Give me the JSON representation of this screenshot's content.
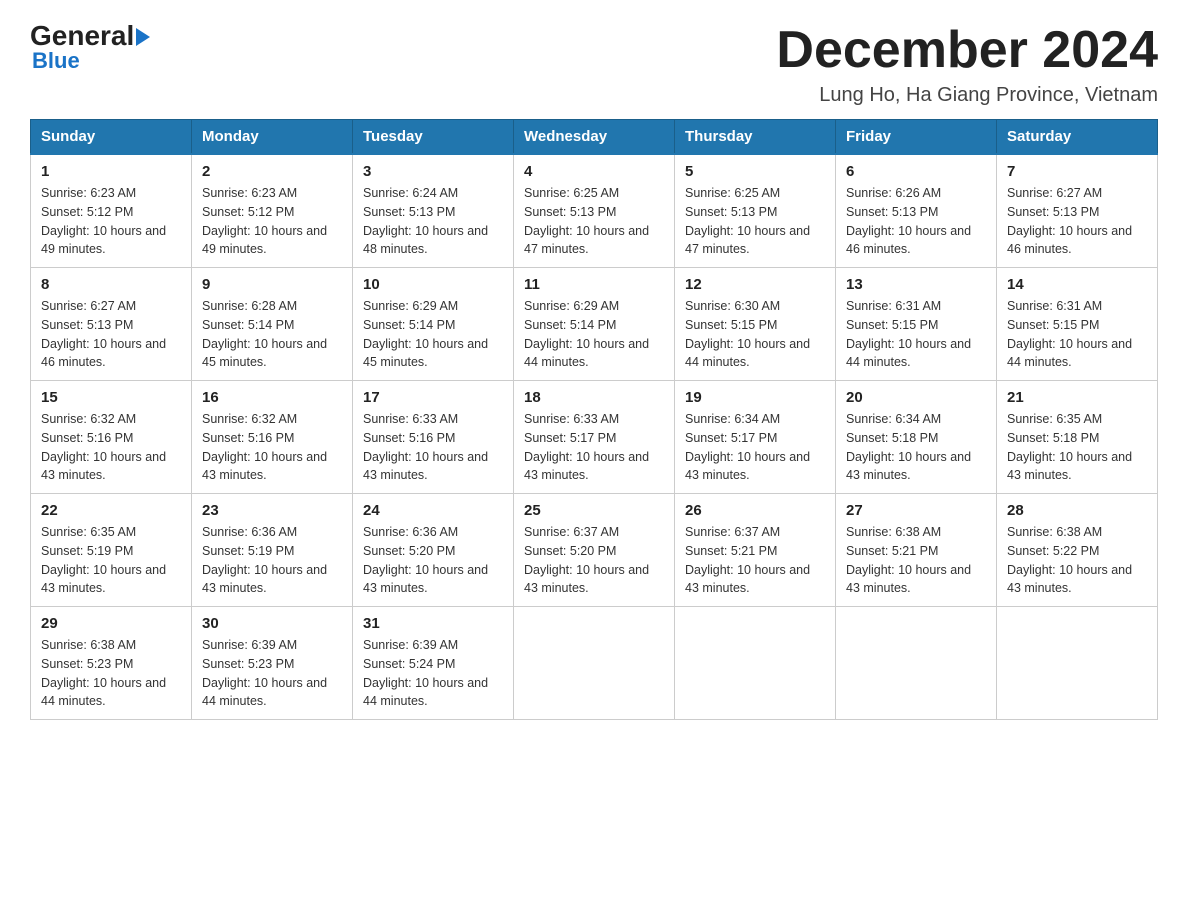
{
  "header": {
    "logo_general": "General",
    "logo_blue": "Blue",
    "main_title": "December 2024",
    "subtitle": "Lung Ho, Ha Giang Province, Vietnam"
  },
  "days_header": [
    "Sunday",
    "Monday",
    "Tuesday",
    "Wednesday",
    "Thursday",
    "Friday",
    "Saturday"
  ],
  "weeks": [
    [
      {
        "day": "1",
        "sunrise": "6:23 AM",
        "sunset": "5:12 PM",
        "daylight": "10 hours and 49 minutes."
      },
      {
        "day": "2",
        "sunrise": "6:23 AM",
        "sunset": "5:12 PM",
        "daylight": "10 hours and 49 minutes."
      },
      {
        "day": "3",
        "sunrise": "6:24 AM",
        "sunset": "5:13 PM",
        "daylight": "10 hours and 48 minutes."
      },
      {
        "day": "4",
        "sunrise": "6:25 AM",
        "sunset": "5:13 PM",
        "daylight": "10 hours and 47 minutes."
      },
      {
        "day": "5",
        "sunrise": "6:25 AM",
        "sunset": "5:13 PM",
        "daylight": "10 hours and 47 minutes."
      },
      {
        "day": "6",
        "sunrise": "6:26 AM",
        "sunset": "5:13 PM",
        "daylight": "10 hours and 46 minutes."
      },
      {
        "day": "7",
        "sunrise": "6:27 AM",
        "sunset": "5:13 PM",
        "daylight": "10 hours and 46 minutes."
      }
    ],
    [
      {
        "day": "8",
        "sunrise": "6:27 AM",
        "sunset": "5:13 PM",
        "daylight": "10 hours and 46 minutes."
      },
      {
        "day": "9",
        "sunrise": "6:28 AM",
        "sunset": "5:14 PM",
        "daylight": "10 hours and 45 minutes."
      },
      {
        "day": "10",
        "sunrise": "6:29 AM",
        "sunset": "5:14 PM",
        "daylight": "10 hours and 45 minutes."
      },
      {
        "day": "11",
        "sunrise": "6:29 AM",
        "sunset": "5:14 PM",
        "daylight": "10 hours and 44 minutes."
      },
      {
        "day": "12",
        "sunrise": "6:30 AM",
        "sunset": "5:15 PM",
        "daylight": "10 hours and 44 minutes."
      },
      {
        "day": "13",
        "sunrise": "6:31 AM",
        "sunset": "5:15 PM",
        "daylight": "10 hours and 44 minutes."
      },
      {
        "day": "14",
        "sunrise": "6:31 AM",
        "sunset": "5:15 PM",
        "daylight": "10 hours and 44 minutes."
      }
    ],
    [
      {
        "day": "15",
        "sunrise": "6:32 AM",
        "sunset": "5:16 PM",
        "daylight": "10 hours and 43 minutes."
      },
      {
        "day": "16",
        "sunrise": "6:32 AM",
        "sunset": "5:16 PM",
        "daylight": "10 hours and 43 minutes."
      },
      {
        "day": "17",
        "sunrise": "6:33 AM",
        "sunset": "5:16 PM",
        "daylight": "10 hours and 43 minutes."
      },
      {
        "day": "18",
        "sunrise": "6:33 AM",
        "sunset": "5:17 PM",
        "daylight": "10 hours and 43 minutes."
      },
      {
        "day": "19",
        "sunrise": "6:34 AM",
        "sunset": "5:17 PM",
        "daylight": "10 hours and 43 minutes."
      },
      {
        "day": "20",
        "sunrise": "6:34 AM",
        "sunset": "5:18 PM",
        "daylight": "10 hours and 43 minutes."
      },
      {
        "day": "21",
        "sunrise": "6:35 AM",
        "sunset": "5:18 PM",
        "daylight": "10 hours and 43 minutes."
      }
    ],
    [
      {
        "day": "22",
        "sunrise": "6:35 AM",
        "sunset": "5:19 PM",
        "daylight": "10 hours and 43 minutes."
      },
      {
        "day": "23",
        "sunrise": "6:36 AM",
        "sunset": "5:19 PM",
        "daylight": "10 hours and 43 minutes."
      },
      {
        "day": "24",
        "sunrise": "6:36 AM",
        "sunset": "5:20 PM",
        "daylight": "10 hours and 43 minutes."
      },
      {
        "day": "25",
        "sunrise": "6:37 AM",
        "sunset": "5:20 PM",
        "daylight": "10 hours and 43 minutes."
      },
      {
        "day": "26",
        "sunrise": "6:37 AM",
        "sunset": "5:21 PM",
        "daylight": "10 hours and 43 minutes."
      },
      {
        "day": "27",
        "sunrise": "6:38 AM",
        "sunset": "5:21 PM",
        "daylight": "10 hours and 43 minutes."
      },
      {
        "day": "28",
        "sunrise": "6:38 AM",
        "sunset": "5:22 PM",
        "daylight": "10 hours and 43 minutes."
      }
    ],
    [
      {
        "day": "29",
        "sunrise": "6:38 AM",
        "sunset": "5:23 PM",
        "daylight": "10 hours and 44 minutes."
      },
      {
        "day": "30",
        "sunrise": "6:39 AM",
        "sunset": "5:23 PM",
        "daylight": "10 hours and 44 minutes."
      },
      {
        "day": "31",
        "sunrise": "6:39 AM",
        "sunset": "5:24 PM",
        "daylight": "10 hours and 44 minutes."
      },
      null,
      null,
      null,
      null
    ]
  ]
}
